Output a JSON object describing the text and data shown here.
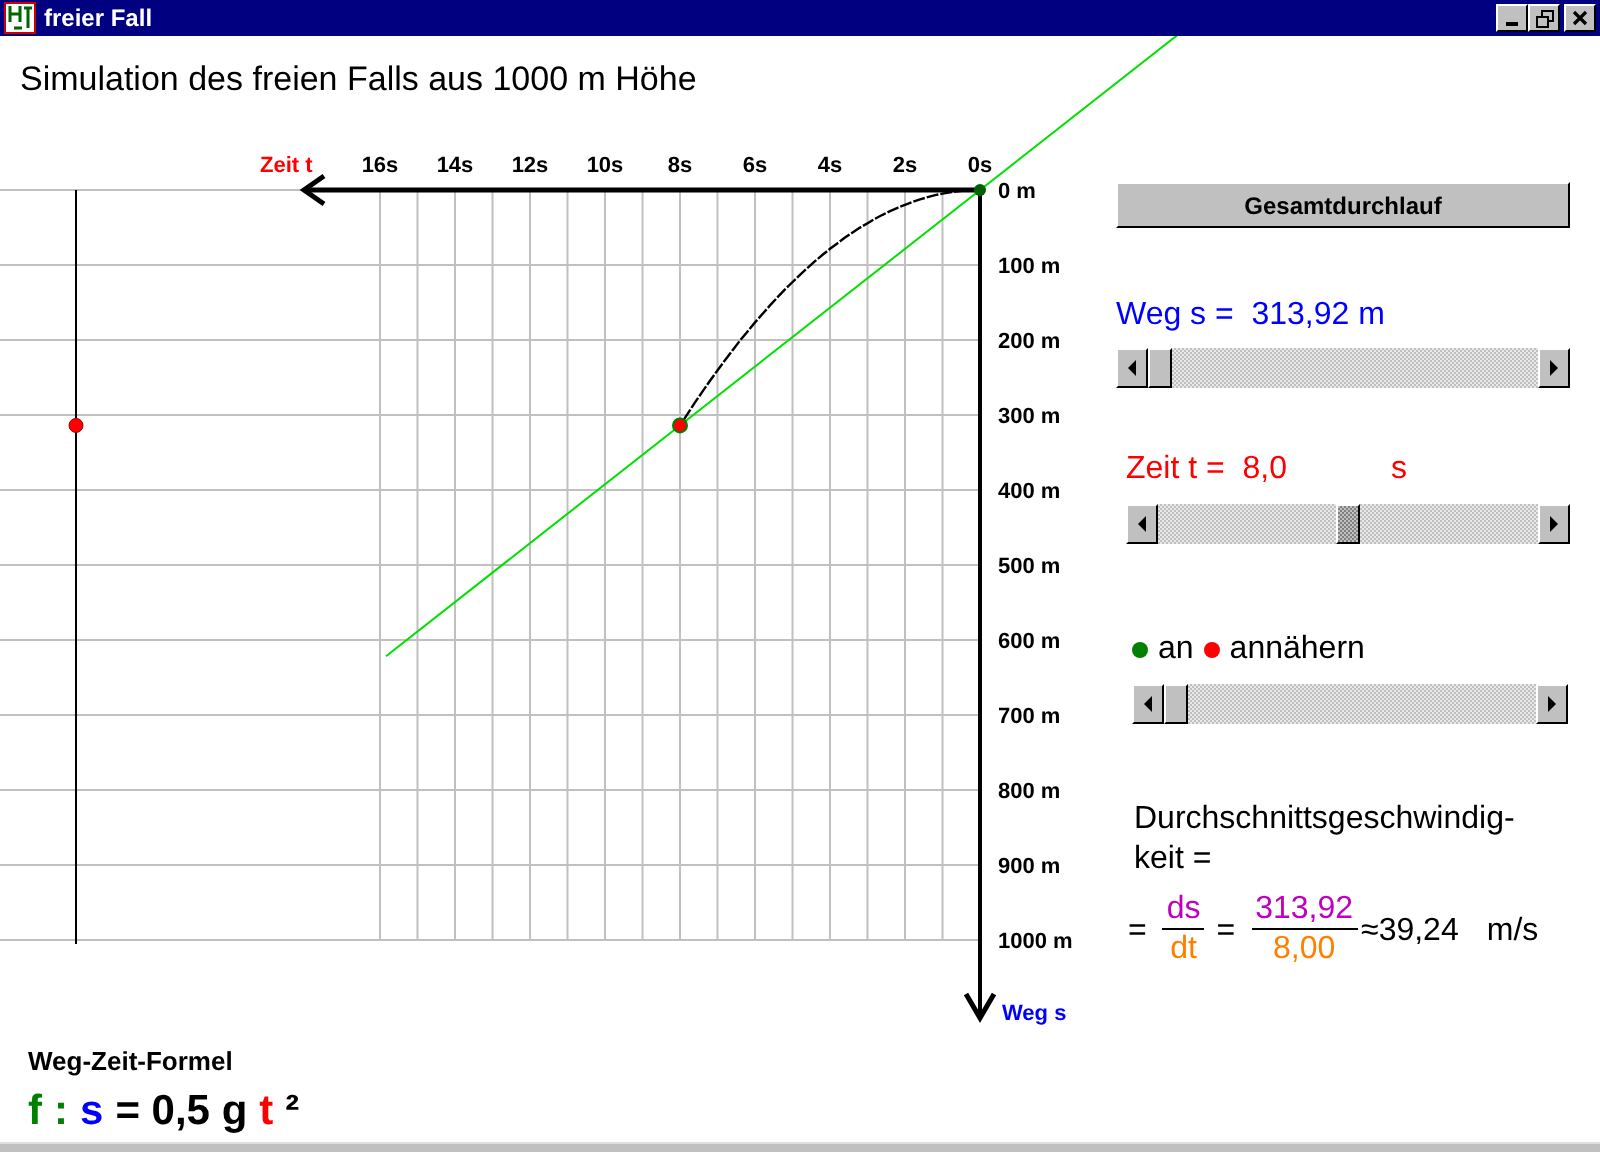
{
  "window": {
    "title": "freier Fall"
  },
  "heading": "Simulation des freien Falls aus 1000 m Höhe",
  "diagram": {
    "x_axis_label": "Zeit t",
    "x_ticks": [
      "16s",
      "14s",
      "12s",
      "10s",
      "8s",
      "6s",
      "4s",
      "2s",
      "0s"
    ],
    "y_axis_label": "Weg s",
    "y_ticks": [
      "0 m",
      "100 m",
      "200 m",
      "300 m",
      "400 m",
      "500 m",
      "600 m",
      "700 m",
      "800 m",
      "900 m",
      "1000 m"
    ]
  },
  "run_button": "Gesamtdurchlauf",
  "distance": {
    "label": "Weg s =",
    "value": "313,92",
    "unit": "m",
    "level": 0.0
  },
  "time": {
    "label": "Zeit t =",
    "value": "8,0",
    "unit": "s",
    "level": 0.5
  },
  "approach": {
    "legend": [
      {
        "label": "an",
        "color": "#008000"
      },
      {
        "label": "annähern",
        "color": "#ff0000"
      }
    ],
    "level": 0.0
  },
  "average_speed": {
    "lines": [
      "Durchschnittsgeschwindig-",
      "keit ="
    ],
    "eq1": "=",
    "num1": "ds",
    "den1": "dt",
    "eq2": "=",
    "num2": "313,92",
    "den2": "8,00",
    "result": "≈39,24",
    "unit": "m/s"
  },
  "formula_section": {
    "title": "Weg-Zeit-Formel",
    "parts": [
      {
        "text": "f",
        "color": "#008000"
      },
      {
        "text": ":",
        "color": "#008000"
      },
      {
        "text": "s",
        "color": "#0000ff"
      },
      {
        "text": "= 0,5 g",
        "color": "#000000"
      },
      {
        "text": "t",
        "color": "#ff0000"
      },
      {
        "text": "²",
        "color": "#000000"
      }
    ]
  }
}
